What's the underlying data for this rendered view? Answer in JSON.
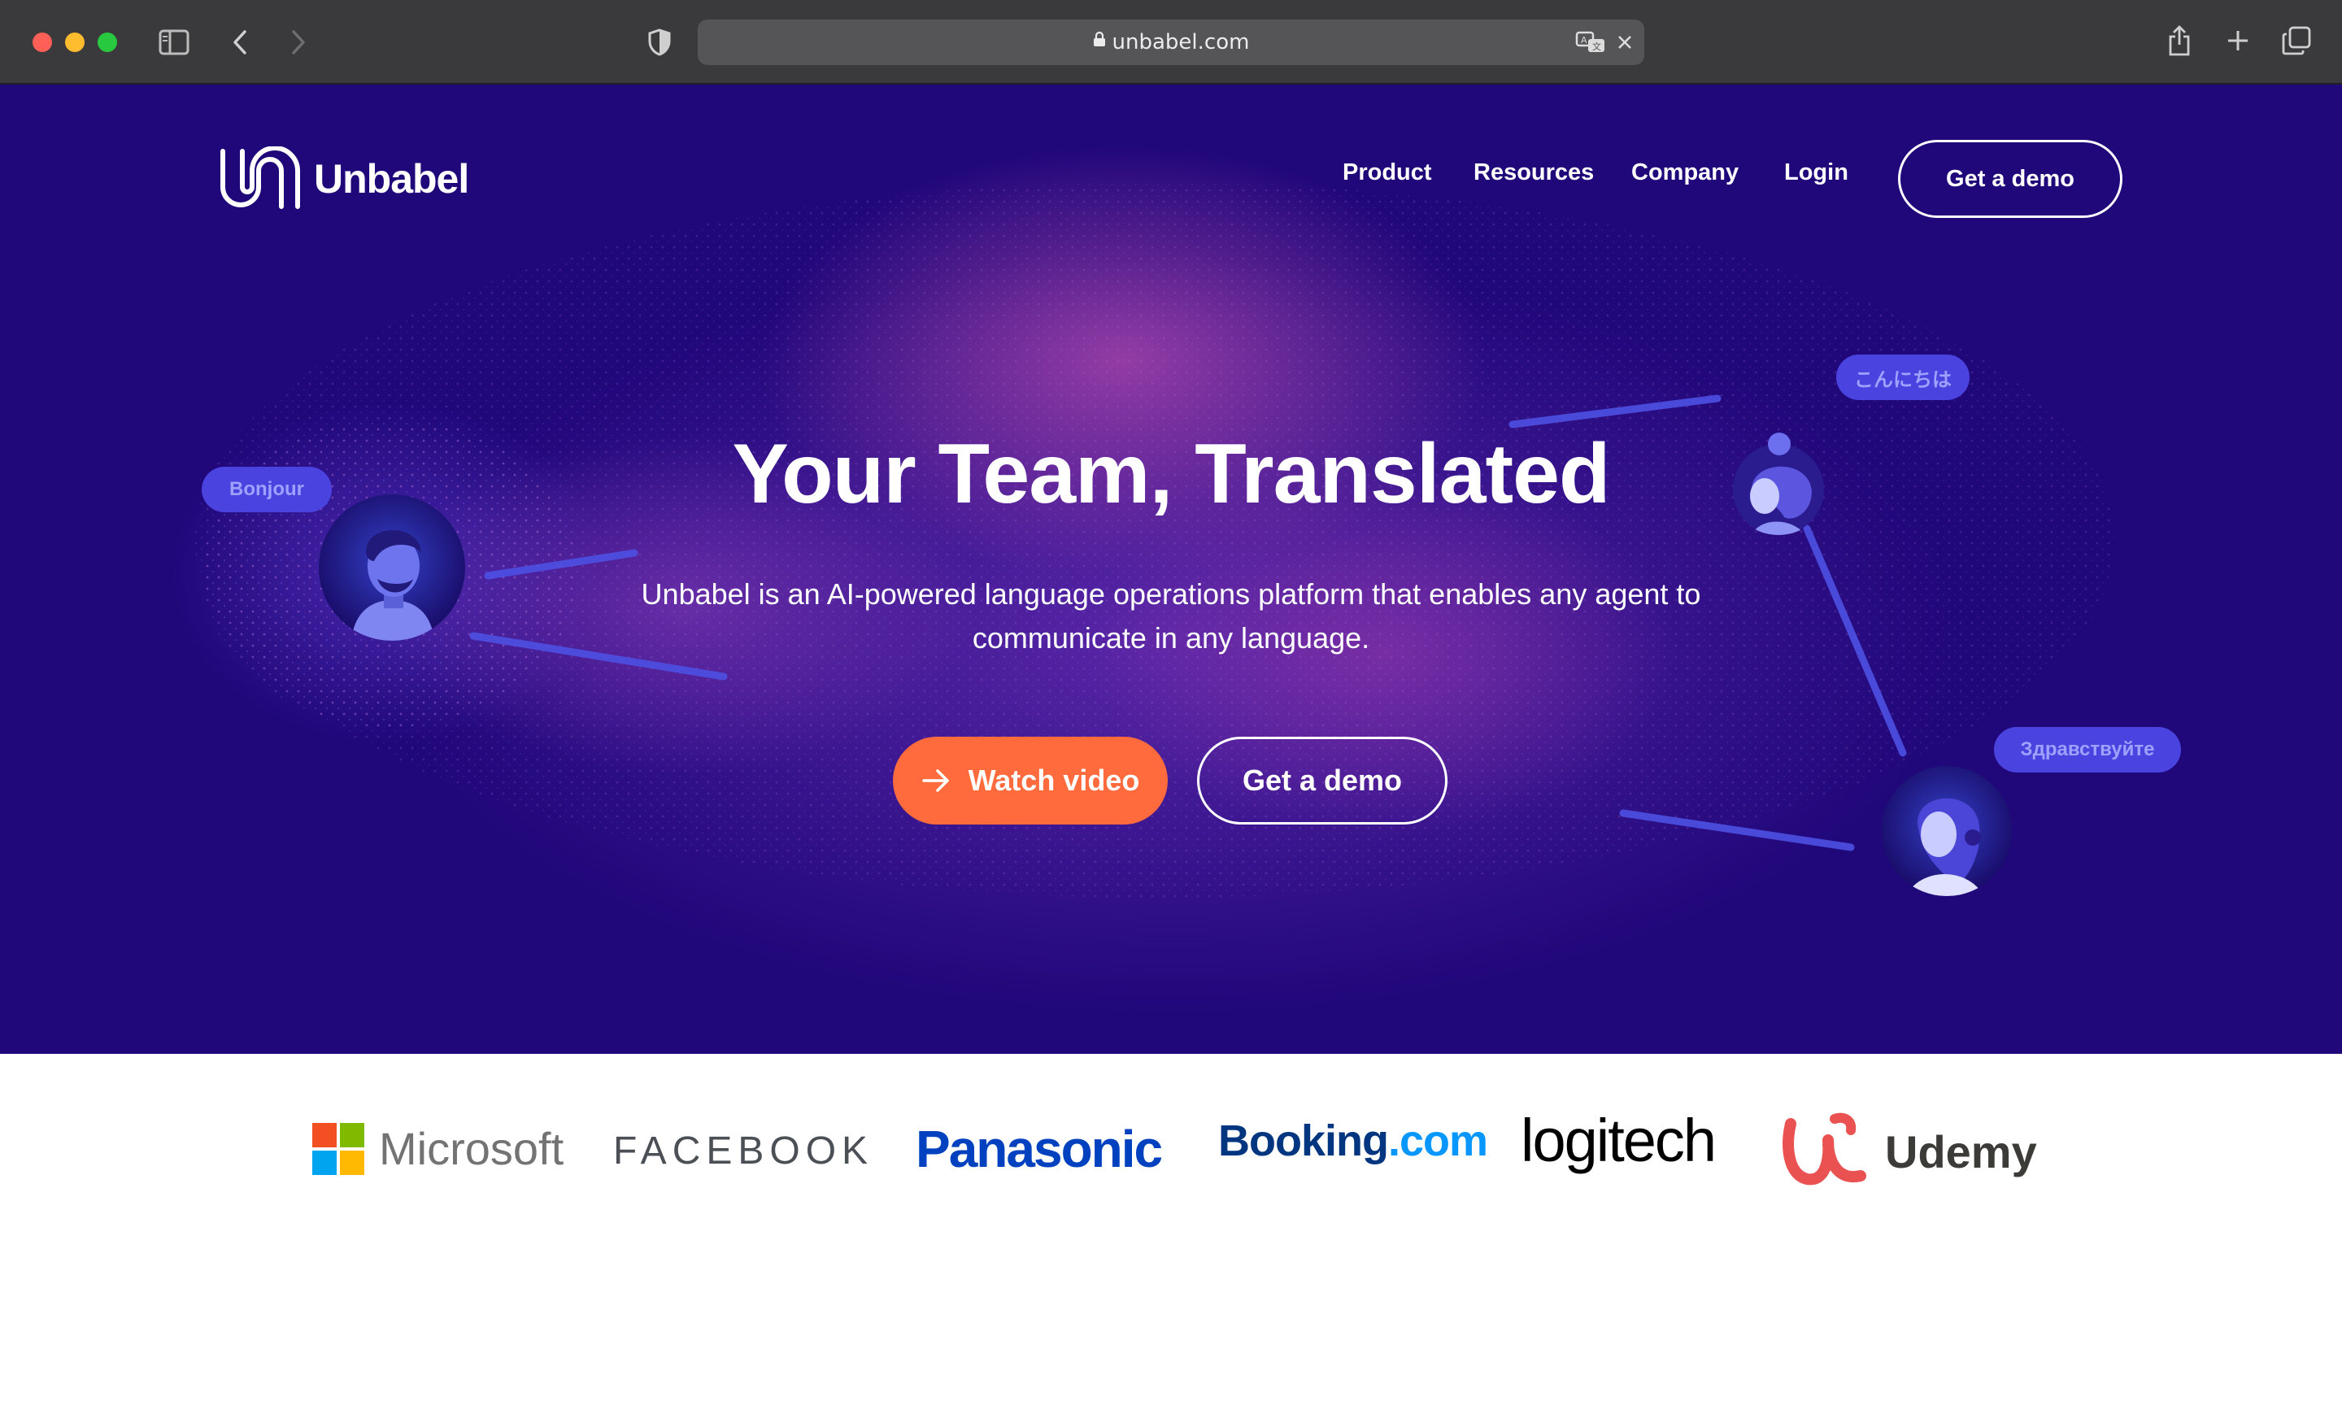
{
  "browser": {
    "url": "unbabel.com"
  },
  "site": {
    "logo_text": "Unbabel",
    "nav": {
      "product": "Product",
      "resources": "Resources",
      "company": "Company",
      "login": "Login",
      "demo": "Get a demo"
    }
  },
  "hero": {
    "title": "Your Team, Translated",
    "subtitle_line1": "Unbabel is an AI-powered language operations platform that enables any agent to",
    "subtitle_line2": "communicate in any language.",
    "watch_label": "Watch video",
    "demo_label": "Get a demo",
    "greetings": {
      "french": "Bonjour",
      "japanese": "こんにちは",
      "russian": "Здравствуйте"
    }
  },
  "clients": {
    "microsoft": "Microsoft",
    "facebook": "FACEBOOK",
    "panasonic": "Panasonic",
    "booking_a": "Booking",
    "booking_b": ".com",
    "logitech": "logitech",
    "udemy": "Udemy"
  },
  "colors": {
    "hero_bg": "#20077a",
    "accent": "#ff6b3d",
    "greeting_tag": "#4a43e0"
  }
}
